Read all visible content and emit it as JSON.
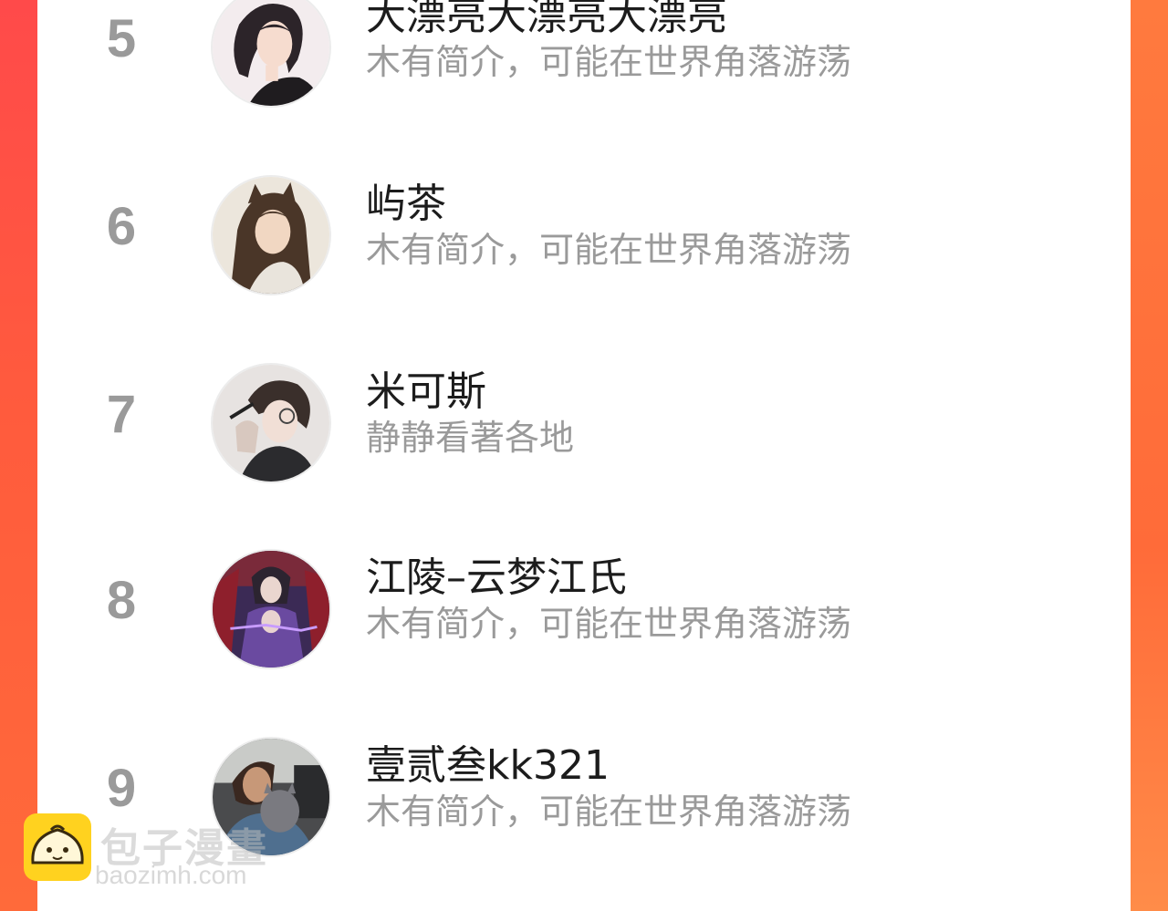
{
  "ranking": {
    "items": [
      {
        "rank": "5",
        "name": "大漂亮大漂亮大漂亮",
        "bio": "木有简介，可能在世界角落游荡",
        "avatar_icon": "avatar-girl-short-hair"
      },
      {
        "rank": "6",
        "name": "屿茶",
        "bio": "木有简介，可能在世界角落游荡",
        "avatar_icon": "avatar-catgirl-long-hair"
      },
      {
        "rank": "7",
        "name": "米可斯",
        "bio": "静静看著各地",
        "avatar_icon": "avatar-boy-glasses"
      },
      {
        "rank": "8",
        "name": "江陵–云梦江氏",
        "bio": "木有简介，可能在世界角落游荡",
        "avatar_icon": "avatar-anime-purple"
      },
      {
        "rank": "9",
        "name": "壹贰叁kk321",
        "bio": "木有简介，可能在世界角落游荡",
        "avatar_icon": "avatar-photo-cat"
      }
    ]
  },
  "watermark": {
    "title": "包子漫畫",
    "url": "baozimh.com",
    "icon": "bun-logo-icon"
  },
  "colors": {
    "background_left": "#ff4a4a",
    "background_right": "#ff7a3e",
    "panel": "#ffffff",
    "rank_text": "#9a9a9a",
    "name_text": "#1c1c1c",
    "bio_text": "#9a9a9a",
    "watermark_icon": "#ffd21f"
  }
}
